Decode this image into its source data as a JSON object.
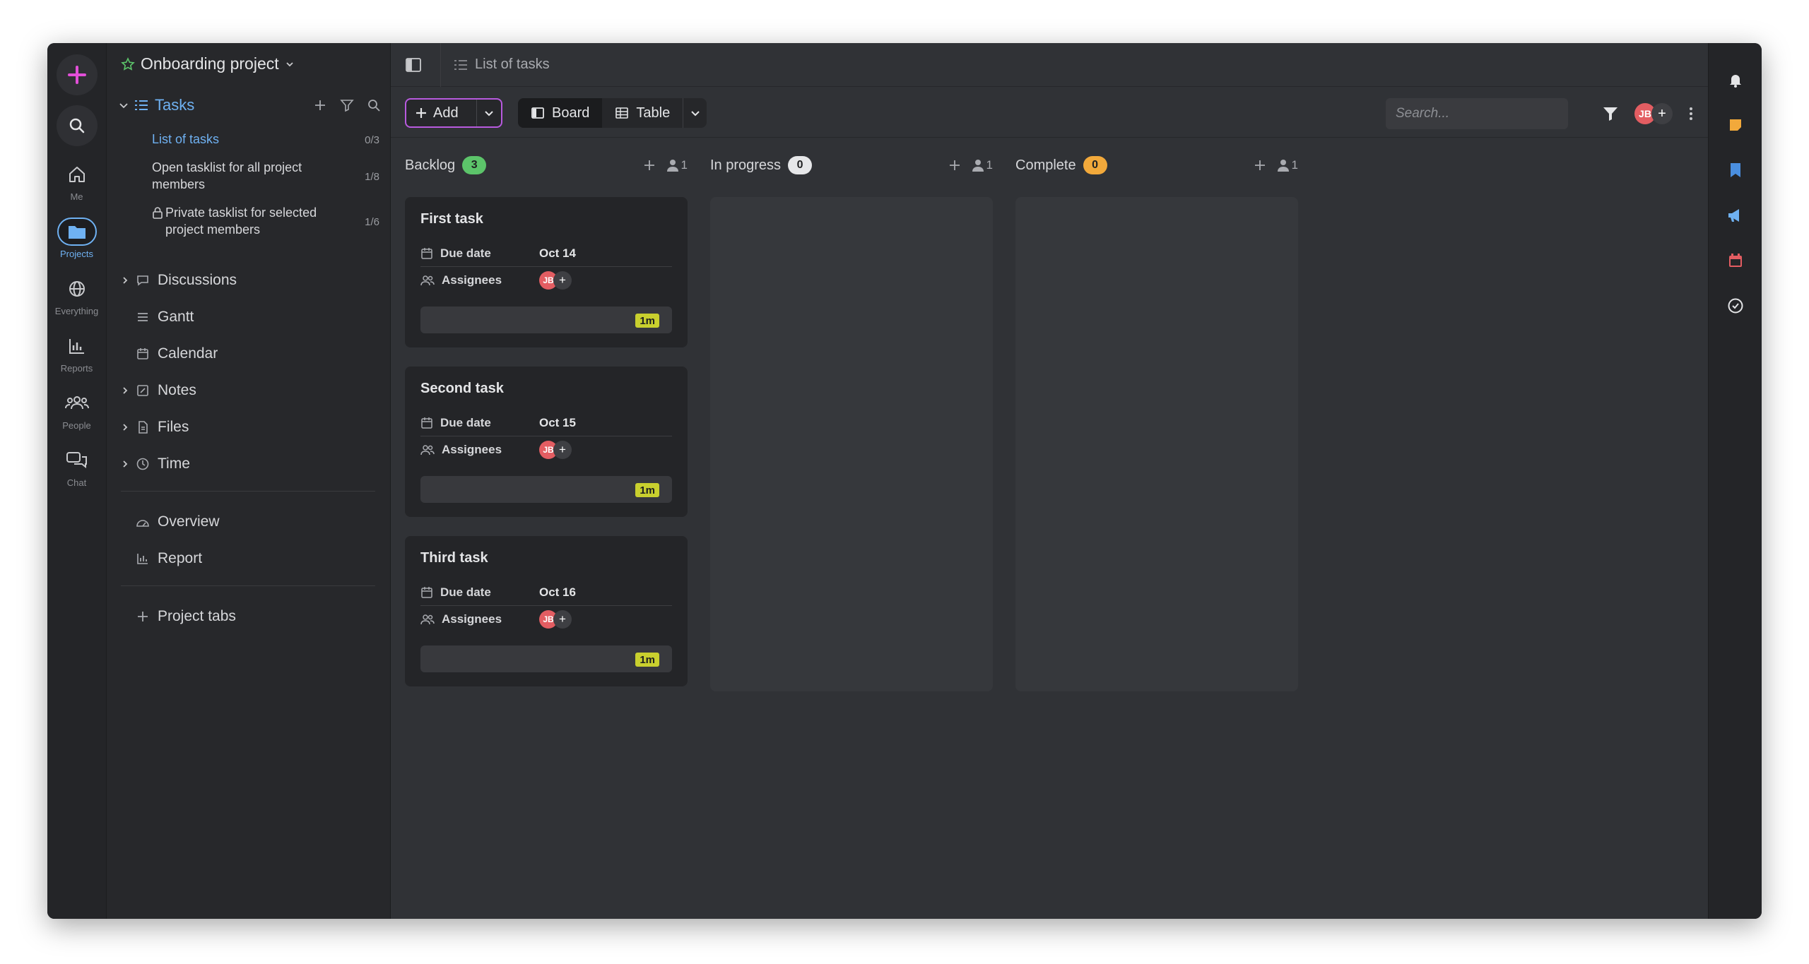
{
  "rail": {
    "items": [
      {
        "label": "Me",
        "icon": "home-icon"
      },
      {
        "label": "Projects",
        "icon": "folder-icon"
      },
      {
        "label": "Everything",
        "icon": "globe-icon"
      },
      {
        "label": "Reports",
        "icon": "bar-chart-icon"
      },
      {
        "label": "People",
        "icon": "people-icon"
      },
      {
        "label": "Chat",
        "icon": "chat-icon"
      }
    ]
  },
  "sidebar": {
    "project_title": "Onboarding project",
    "tasks_label": "Tasks",
    "tasklists": [
      {
        "name": "List of tasks",
        "count": "0/3"
      },
      {
        "name": "Open tasklist for all project members",
        "count": "1/8"
      },
      {
        "name": "Private tasklist for selected project members",
        "count": "1/6"
      }
    ],
    "nav": [
      "Discussions",
      "Gantt",
      "Calendar",
      "Notes",
      "Files",
      "Time"
    ],
    "extra": [
      "Overview",
      "Report"
    ],
    "project_tabs": "Project tabs"
  },
  "topbar": {
    "breadcrumb": "List of tasks"
  },
  "toolbar": {
    "add_label": "Add",
    "board_label": "Board",
    "table_label": "Table",
    "search_placeholder": "Search...",
    "avatar_initials": "JB"
  },
  "board": {
    "columns": [
      {
        "name": "Backlog",
        "count": "3",
        "badge_color": "#5cc46a",
        "members": "1"
      },
      {
        "name": "In progress",
        "count": "0",
        "badge_color": "#e6e7e9",
        "members": "1"
      },
      {
        "name": "Complete",
        "count": "0",
        "badge_color": "#f2a93b",
        "members": "1"
      }
    ],
    "field_due": "Due date",
    "field_assignees": "Assignees",
    "cards": [
      {
        "title": "First task",
        "due": "Oct 14",
        "assignee": "JB",
        "time": "1m"
      },
      {
        "title": "Second task",
        "due": "Oct 15",
        "assignee": "JB",
        "time": "1m"
      },
      {
        "title": "Third task",
        "due": "Oct 16",
        "assignee": "JB",
        "time": "1m"
      }
    ]
  },
  "colors": {
    "accent": "#6fb1f2",
    "add_border": "#b85adf",
    "time_chip": "#c9d02e"
  }
}
